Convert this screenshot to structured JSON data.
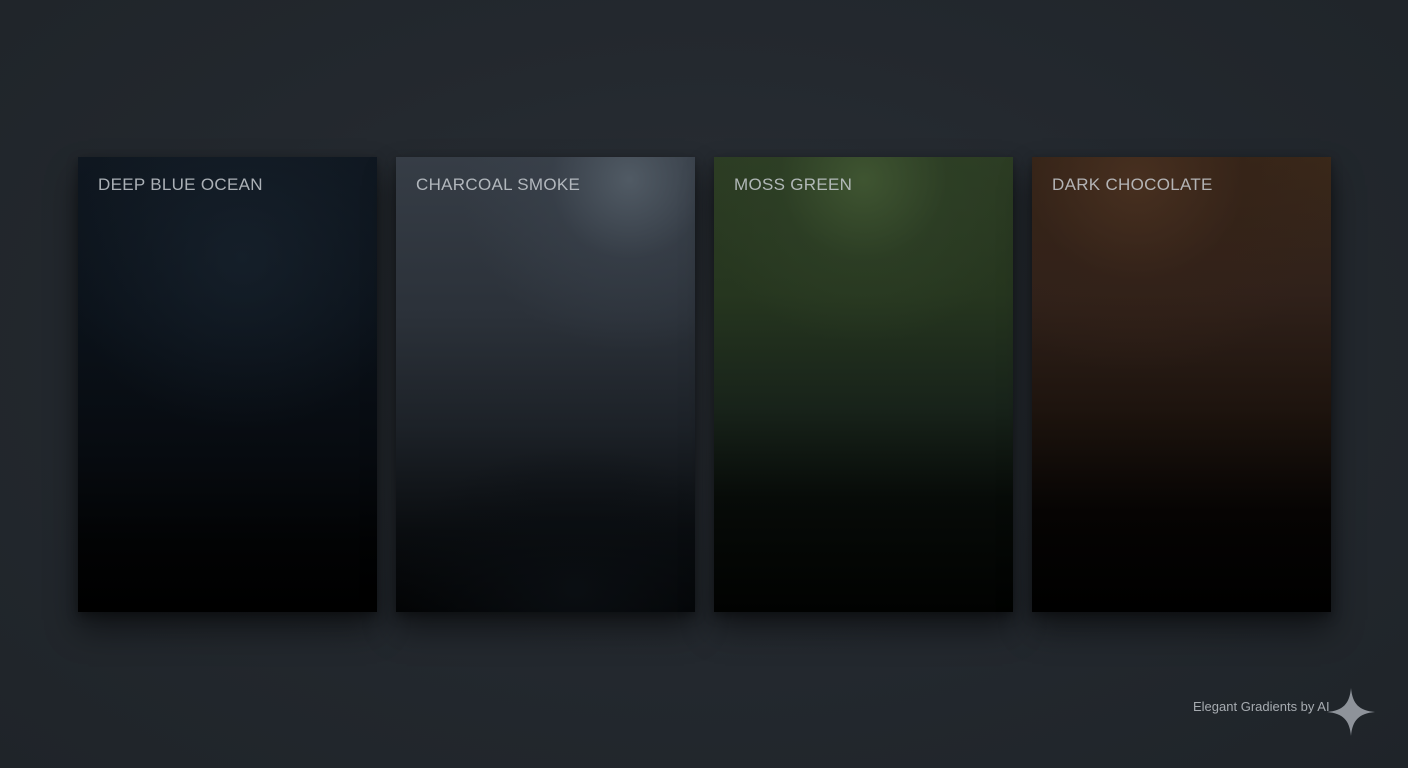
{
  "cards": [
    {
      "label": "DEEP BLUE OCEAN",
      "gradient": "deep-blue-ocean"
    },
    {
      "label": "CHARCOAL SMOKE",
      "gradient": "charcoal-smoke"
    },
    {
      "label": "MOSS GREEN",
      "gradient": "moss-green"
    },
    {
      "label": "DARK CHOCOLATE",
      "gradient": "dark-chocolate"
    }
  ],
  "footer": {
    "text": "Elegant Gradients by AI",
    "icon": "sparkle-icon"
  },
  "colors": {
    "background": "#23282e",
    "label_text": "#cdd2d7",
    "deep_blue_ocean": [
      "#0f1720",
      "#000000"
    ],
    "charcoal_smoke": [
      "#525c66",
      "#020304"
    ],
    "moss_green": [
      "#405632",
      "#010201"
    ],
    "dark_chocolate": [
      "#483020",
      "#000000"
    ]
  }
}
